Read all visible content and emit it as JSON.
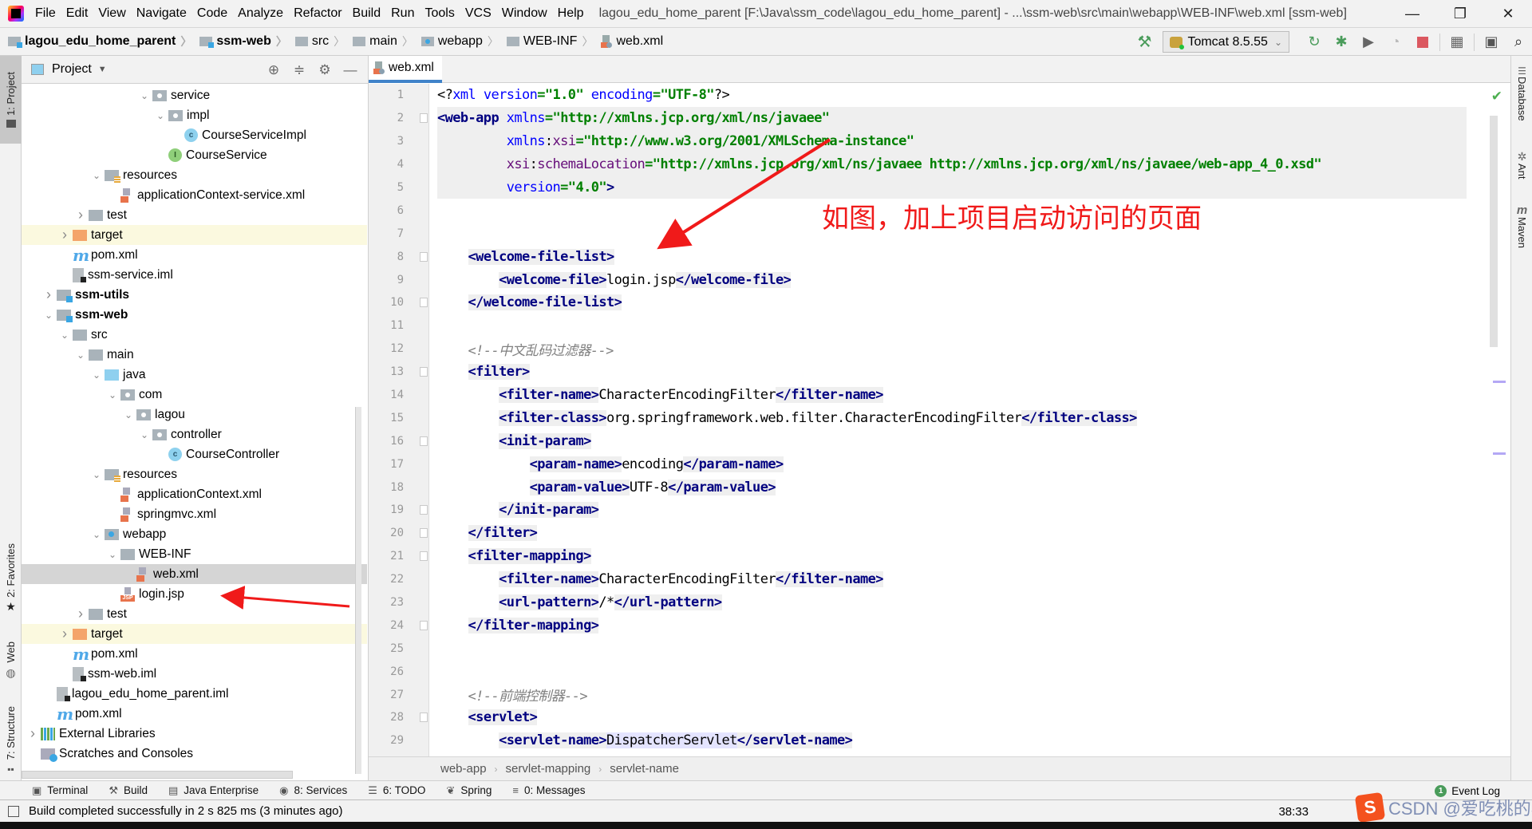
{
  "window": {
    "title": "lagou_edu_home_parent [F:\\Java\\ssm_code\\lagou_edu_home_parent] - ...\\ssm-web\\src\\main\\webapp\\WEB-INF\\web.xml [ssm-web]",
    "controls": {
      "minimize": "—",
      "restore": "❐",
      "close": "✕"
    }
  },
  "menu": [
    "File",
    "Edit",
    "View",
    "Navigate",
    "Code",
    "Analyze",
    "Refactor",
    "Build",
    "Run",
    "Tools",
    "VCS",
    "Window",
    "Help"
  ],
  "navbar": {
    "breadcrumbs": [
      {
        "label": "lagou_edu_home_parent",
        "icon": "module-folder-icon"
      },
      {
        "label": "ssm-web",
        "icon": "module-folder-icon"
      },
      {
        "label": "src",
        "icon": "folder-icon"
      },
      {
        "label": "main",
        "icon": "folder-icon"
      },
      {
        "label": "webapp",
        "icon": "web-folder-icon"
      },
      {
        "label": "WEB-INF",
        "icon": "folder-icon"
      },
      {
        "label": "web.xml",
        "icon": "xml-file-icon"
      }
    ],
    "run_config": "Tomcat 8.5.55",
    "toolbar_icons": [
      "build-hammer-icon",
      "rerun-icon",
      "debug-icon",
      "run-with-coverage-icon",
      "profile-icon",
      "stop-icon",
      "project-structure-icon",
      "run-anything-icon",
      "search-icon"
    ]
  },
  "left_strip": {
    "tabs": [
      "1: Project",
      "2: Favorites",
      "Web",
      "7: Structure"
    ]
  },
  "right_strip": {
    "tabs": [
      "Database",
      "Ant",
      "Maven"
    ]
  },
  "project_panel": {
    "title": "Project",
    "tools": [
      "locate-icon",
      "collapse-all-icon",
      "settings-icon",
      "hide-icon"
    ],
    "tree": [
      {
        "label": "service",
        "indent": 7,
        "arrow": "down",
        "icon": "pkg"
      },
      {
        "label": "impl",
        "indent": 8,
        "arrow": "down",
        "icon": "pkg"
      },
      {
        "label": "CourseServiceImpl",
        "indent": 9,
        "arrow": "",
        "icon": "class"
      },
      {
        "label": "CourseService",
        "indent": 8,
        "arrow": "",
        "icon": "iface"
      },
      {
        "label": "resources",
        "indent": 4,
        "arrow": "down",
        "icon": "res"
      },
      {
        "label": "applicationContext-service.xml",
        "indent": 5,
        "arrow": "",
        "icon": "xml"
      },
      {
        "label": "test",
        "indent": 3,
        "arrow": "right",
        "icon": "folder"
      },
      {
        "label": "target",
        "indent": 2,
        "arrow": "right",
        "icon": "target",
        "highlight": "yellow"
      },
      {
        "label": "pom.xml",
        "indent": 2,
        "arrow": "",
        "icon": "maven"
      },
      {
        "label": "ssm-service.iml",
        "indent": 2,
        "arrow": "",
        "icon": "iml"
      },
      {
        "label": "ssm-utils",
        "indent": 1,
        "arrow": "right",
        "icon": "module",
        "bold": true
      },
      {
        "label": "ssm-web",
        "indent": 1,
        "arrow": "down",
        "icon": "module",
        "bold": true
      },
      {
        "label": "src",
        "indent": 2,
        "arrow": "down",
        "icon": "folder"
      },
      {
        "label": "main",
        "indent": 3,
        "arrow": "down",
        "icon": "folder"
      },
      {
        "label": "java",
        "indent": 4,
        "arrow": "down",
        "icon": "src"
      },
      {
        "label": "com",
        "indent": 5,
        "arrow": "down",
        "icon": "pkg"
      },
      {
        "label": "lagou",
        "indent": 6,
        "arrow": "down",
        "icon": "pkg"
      },
      {
        "label": "controller",
        "indent": 7,
        "arrow": "down",
        "icon": "pkg"
      },
      {
        "label": "CourseController",
        "indent": 8,
        "arrow": "",
        "icon": "class"
      },
      {
        "label": "resources",
        "indent": 4,
        "arrow": "down",
        "icon": "res"
      },
      {
        "label": "applicationContext.xml",
        "indent": 5,
        "arrow": "",
        "icon": "xml"
      },
      {
        "label": "springmvc.xml",
        "indent": 5,
        "arrow": "",
        "icon": "xml"
      },
      {
        "label": "webapp",
        "indent": 4,
        "arrow": "down",
        "icon": "webroot"
      },
      {
        "label": "WEB-INF",
        "indent": 5,
        "arrow": "down",
        "icon": "folder"
      },
      {
        "label": "web.xml",
        "indent": 6,
        "arrow": "",
        "icon": "xml",
        "selected": true
      },
      {
        "label": "login.jsp",
        "indent": 5,
        "arrow": "",
        "icon": "jsp"
      },
      {
        "label": "test",
        "indent": 3,
        "arrow": "right",
        "icon": "folder"
      },
      {
        "label": "target",
        "indent": 2,
        "arrow": "right",
        "icon": "target",
        "highlight": "yellow"
      },
      {
        "label": "pom.xml",
        "indent": 2,
        "arrow": "",
        "icon": "maven"
      },
      {
        "label": "ssm-web.iml",
        "indent": 2,
        "arrow": "",
        "icon": "iml"
      },
      {
        "label": "lagou_edu_home_parent.iml",
        "indent": 1,
        "arrow": "",
        "icon": "iml"
      },
      {
        "label": "pom.xml",
        "indent": 1,
        "arrow": "",
        "icon": "maven"
      },
      {
        "label": "External Libraries",
        "indent": 0,
        "arrow": "right",
        "icon": "libs"
      },
      {
        "label": "Scratches and Consoles",
        "indent": 0,
        "arrow": "",
        "icon": "scratch"
      }
    ]
  },
  "editor": {
    "tab": "web.xml",
    "lines": [
      {
        "n": "1",
        "html": "<span class=\"tx\">&lt;?</span><span class=\"at\">xml version</span><span class=\"sv\">=\"1.0\"</span> <span class=\"at\">encoding</span><span class=\"sv\">=\"UTF-8\"</span><span class=\"tx\">?&gt;</span>"
      },
      {
        "n": "2",
        "fold": true,
        "html": "<span class=\"tg\">&lt;web-app</span> <span class=\"at\">xmlns</span><span class=\"sv\">=\"http://xmlns.jcp.org/xml/ns/javaee\"</span>"
      },
      {
        "n": "3",
        "html": "         <span class=\"at\">xmlns</span><span class=\"tx\">:</span><span class=\"ns\">xsi</span><span class=\"sv\">=\"http://www.w3.org/2001/XMLSchema-instance\"</span>"
      },
      {
        "n": "4",
        "html": "         <span class=\"ns\">xsi</span><span class=\"tx\">:</span><span class=\"ns\">schemaLocation</span><span class=\"sv\">=\"http://xmlns.jcp.org/xml/ns/javaee http://xmlns.jcp.org/xml/ns/javaee/web-app_4_0.xsd\"</span>"
      },
      {
        "n": "5",
        "html": "         <span class=\"at\">version</span><span class=\"sv\">=\"4.0\"</span><span class=\"tg\">&gt;</span>"
      },
      {
        "n": "6",
        "html": ""
      },
      {
        "n": "7",
        "html": ""
      },
      {
        "n": "8",
        "fold": true,
        "html": "    <span class=\"bgtag\"><span class=\"tg\">&lt;welcome-file-list&gt;</span></span>"
      },
      {
        "n": "9",
        "html": "        <span class=\"bgtag\"><span class=\"tg\">&lt;welcome-file&gt;</span></span><span class=\"tx\">login.jsp</span><span class=\"bgtag\"><span class=\"tg\">&lt;/welcome-file&gt;</span></span>"
      },
      {
        "n": "10",
        "fold": true,
        "html": "    <span class=\"bgtag\"><span class=\"tg\">&lt;/welcome-file-list&gt;</span></span>"
      },
      {
        "n": "11",
        "html": ""
      },
      {
        "n": "12",
        "html": "    <span class=\"cm\">&lt;!--中文乱码过滤器--&gt;</span>"
      },
      {
        "n": "13",
        "fold": true,
        "html": "    <span class=\"bgtag\"><span class=\"tg\">&lt;filter&gt;</span></span>"
      },
      {
        "n": "14",
        "html": "        <span class=\"bgtag\"><span class=\"tg\">&lt;filter-name&gt;</span></span><span class=\"tx\">CharacterEncodingFilter</span><span class=\"bgtag\"><span class=\"tg\">&lt;/filter-name&gt;</span></span>"
      },
      {
        "n": "15",
        "html": "        <span class=\"bgtag\"><span class=\"tg\">&lt;filter-class&gt;</span></span><span class=\"tx\">org.springframework.web.filter.CharacterEncodingFilter</span><span class=\"bgtag\"><span class=\"tg\">&lt;/filter-class&gt;</span></span>"
      },
      {
        "n": "16",
        "fold": true,
        "html": "        <span class=\"bgtag\"><span class=\"tg\">&lt;init-param&gt;</span></span>"
      },
      {
        "n": "17",
        "html": "            <span class=\"bgtag\"><span class=\"tg\">&lt;param-name&gt;</span></span><span class=\"tx\">encoding</span><span class=\"bgtag\"><span class=\"tg\">&lt;/param-name&gt;</span></span>"
      },
      {
        "n": "18",
        "html": "            <span class=\"bgtag\"><span class=\"tg\">&lt;param-value&gt;</span></span><span class=\"tx\">UTF-8</span><span class=\"bgtag\"><span class=\"tg\">&lt;/param-value&gt;</span></span>"
      },
      {
        "n": "19",
        "fold": true,
        "html": "        <span class=\"bgtag\"><span class=\"tg\">&lt;/init-param&gt;</span></span>"
      },
      {
        "n": "20",
        "fold": true,
        "html": "    <span class=\"bgtag\"><span class=\"tg\">&lt;/filter&gt;</span></span>"
      },
      {
        "n": "21",
        "fold": true,
        "html": "    <span class=\"bgtag\"><span class=\"tg\">&lt;filter-mapping&gt;</span></span>"
      },
      {
        "n": "22",
        "html": "        <span class=\"bgtag\"><span class=\"tg\">&lt;filter-name&gt;</span></span><span class=\"tx\">CharacterEncodingFilter</span><span class=\"bgtag\"><span class=\"tg\">&lt;/filter-name&gt;</span></span>"
      },
      {
        "n": "23",
        "html": "        <span class=\"bgtag\"><span class=\"tg\">&lt;url-pattern&gt;</span></span><span class=\"tx\">/*</span><span class=\"bgtag\"><span class=\"tg\">&lt;/url-pattern&gt;</span></span>"
      },
      {
        "n": "24",
        "fold": true,
        "html": "    <span class=\"bgtag\"><span class=\"tg\">&lt;/filter-mapping&gt;</span></span>"
      },
      {
        "n": "25",
        "html": ""
      },
      {
        "n": "26",
        "html": ""
      },
      {
        "n": "27",
        "html": "    <span class=\"cm\">&lt;!--前端控制器--&gt;</span>"
      },
      {
        "n": "28",
        "fold": true,
        "html": "    <span class=\"bgtag\"><span class=\"tg\">&lt;servlet&gt;</span></span>"
      },
      {
        "n": "29",
        "html": "        <span class=\"bgtag\"><span class=\"tg\">&lt;servlet-name&gt;</span></span><span class=\"hlword tx\">DispatcherServlet</span><span class=\"bgtag\"><span class=\"tg\">&lt;/servlet-name&gt;</span></span>"
      }
    ],
    "annotation": "如图，加上项目启动访问的页面",
    "breadcrumbs": [
      "web-app",
      "servlet-mapping",
      "servlet-name"
    ]
  },
  "bottom_toolbar": {
    "tabs": [
      {
        "label": "Terminal",
        "icon": "terminal-icon",
        "glyph": "▣"
      },
      {
        "label": "Build",
        "icon": "build-hammer-icon",
        "glyph": "⚒"
      },
      {
        "label": "Java Enterprise",
        "icon": "java-enterprise-icon",
        "glyph": "▤"
      },
      {
        "label": "8: Services",
        "icon": "services-icon",
        "glyph": "◉"
      },
      {
        "label": "6: TODO",
        "icon": "todo-icon",
        "glyph": "☰"
      },
      {
        "label": "Spring",
        "icon": "spring-leaf-icon",
        "glyph": "❦"
      },
      {
        "label": "0: Messages",
        "icon": "messages-icon",
        "glyph": "≡"
      }
    ],
    "event_log": {
      "label": "Event Log",
      "count": "1"
    }
  },
  "status": {
    "message": "Build completed successfully in 2 s 825 ms (3 minutes ago)",
    "caret": "38:33"
  },
  "watermark": "CSDN @爱吃桃的小羊"
}
